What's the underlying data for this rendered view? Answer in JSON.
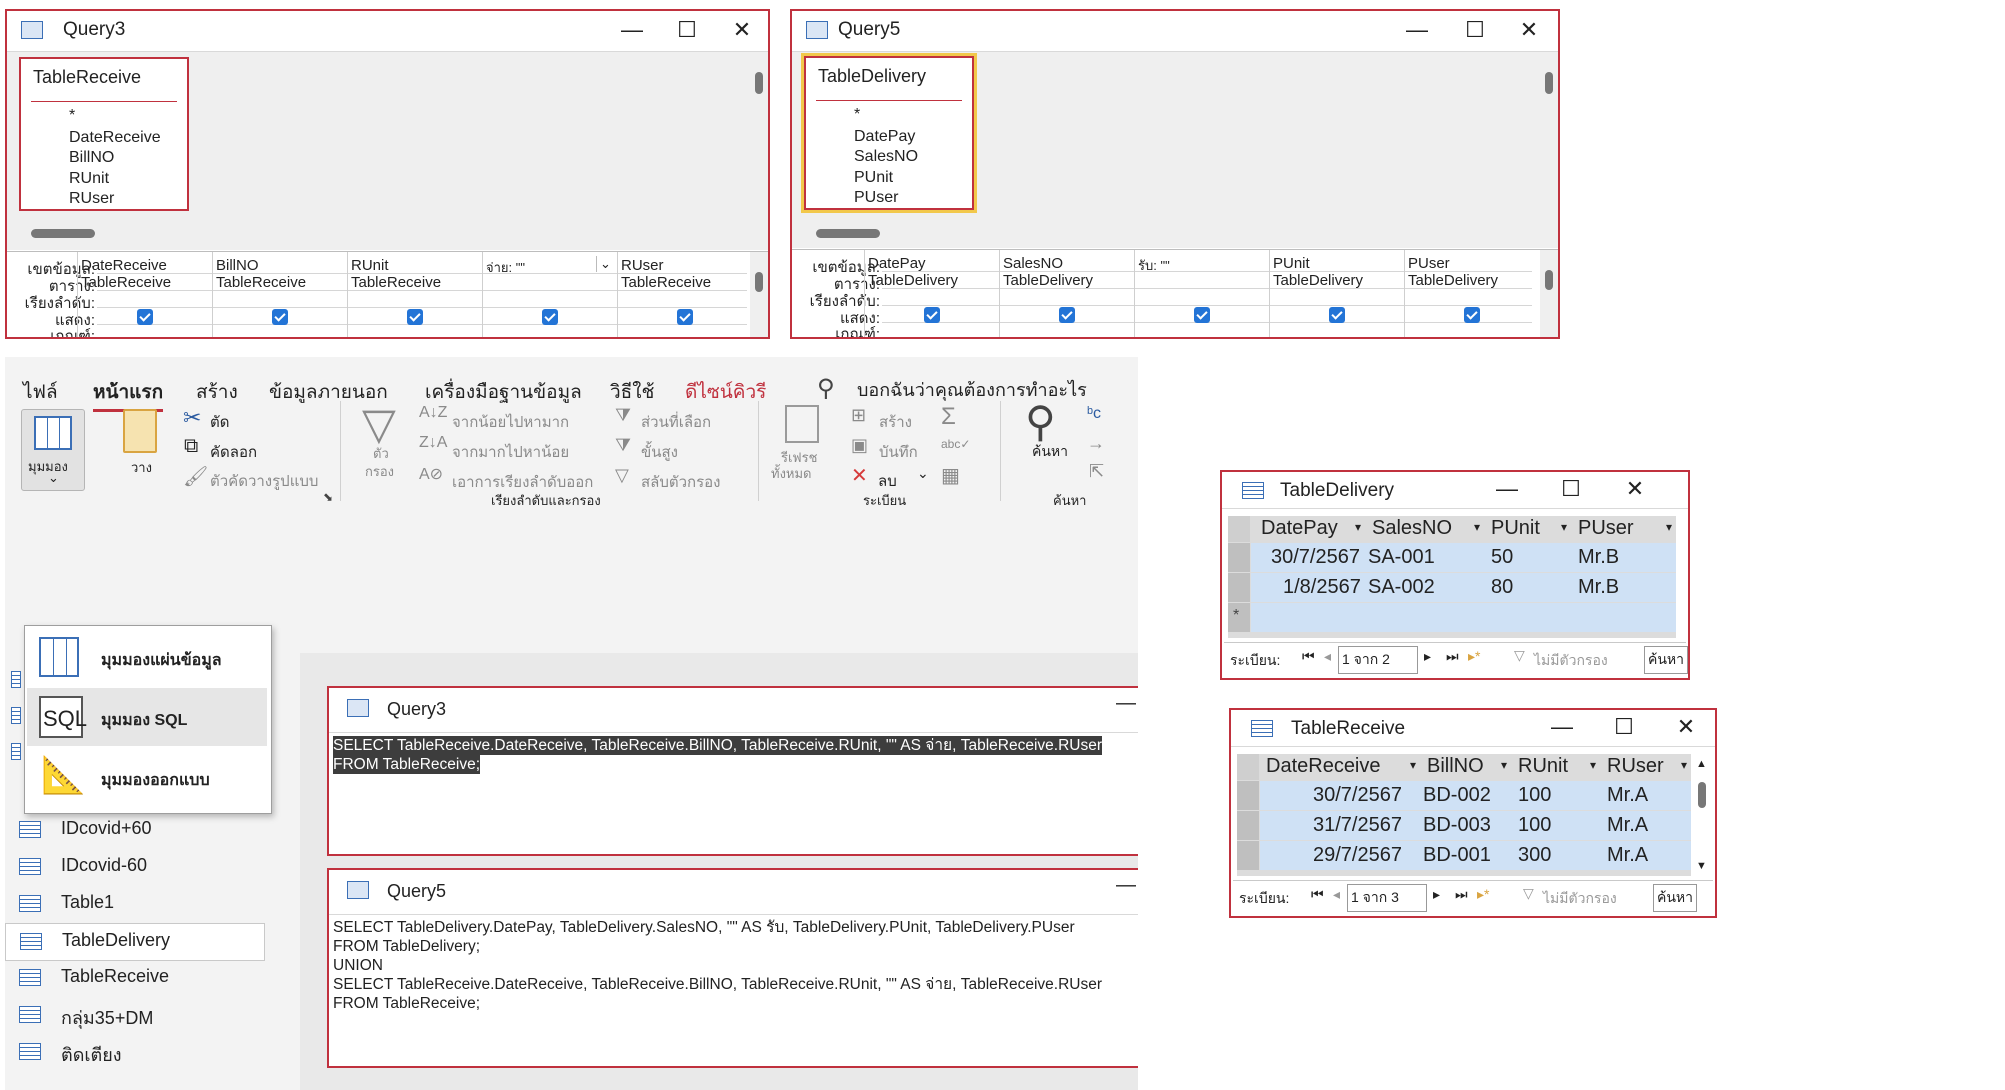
{
  "query3_window": {
    "title": "Query3",
    "table_name": "TableReceive",
    "fields": [
      "*",
      "DateReceive",
      "BillNO",
      "RUnit",
      "RUser"
    ],
    "grid_labels": {
      "field": "เขตข้อมูล:",
      "table": "ตาราง:",
      "sort": "เรียงลำดับ:",
      "show": "แสดง:",
      "criteria": "เกณฑ์:"
    },
    "columns": [
      {
        "field": "DateReceive",
        "table": "TableReceive"
      },
      {
        "field": "BillNO",
        "table": "TableReceive"
      },
      {
        "field": "RUnit",
        "table": "TableReceive"
      },
      {
        "field": "จ่าย: \"\"",
        "table": ""
      },
      {
        "field": "RUser",
        "table": "TableReceive"
      }
    ]
  },
  "query5_window": {
    "title": "Query5",
    "table_name": "TableDelivery",
    "fields": [
      "*",
      "DatePay",
      "SalesNO",
      "PUnit",
      "PUser"
    ],
    "grid_labels": {
      "field": "เขตข้อมูล:",
      "table": "ตาราง:",
      "sort": "เรียงลำดับ:",
      "show": "แสดง:",
      "criteria": "เกณฑ์:"
    },
    "columns": [
      {
        "field": "DatePay",
        "table": "TableDelivery"
      },
      {
        "field": "SalesNO",
        "table": "TableDelivery"
      },
      {
        "field": "รับ: \"\"",
        "table": ""
      },
      {
        "field": "PUnit",
        "table": "TableDelivery"
      },
      {
        "field": "PUser",
        "table": "TableDelivery"
      }
    ]
  },
  "ribbon": {
    "tabs": [
      "ไฟล์",
      "หน้าแรก",
      "สร้าง",
      "ข้อมูลภายนอก",
      "เครื่องมือฐานข้อมูล",
      "วิธีใช้",
      "ดีไซน์คิวรี"
    ],
    "tell_me": "บอกฉันว่าคุณต้องการทำอะไร",
    "view_label": "มุมมอง",
    "paste_label": "วาง",
    "cut_label": "ตัด",
    "copy_label": "คัดลอก",
    "format_painter_label": "ตัวคัดวางรูปแบบ",
    "filter_label_1": "ตัว",
    "filter_label_2": "กรอง",
    "asc_label": "จากน้อยไปหามาก",
    "desc_label": "จากมากไปหาน้อย",
    "remove_sort_label": "เอาการเรียงลำดับออก",
    "selection_label": "ส่วนที่เลือก",
    "advanced_label": "ขั้นสูง",
    "toggle_filter_label": "สลับตัวกรอง",
    "sort_filter_group": "เรียงลำดับและกรอง",
    "refresh_label_1": "รีเฟรช",
    "refresh_label_2": "ทั้งหมด",
    "new_label": "สร้าง",
    "save_label": "บันทึก",
    "delete_label": "ลบ",
    "records_group": "ระเบียน",
    "find_label": "ค้นหา",
    "find_group": "ค้นหา"
  },
  "view_menu": {
    "items": [
      "มุมมองแผ่นข้อมูล",
      "มุมมอง SQL",
      "มุมมองออกแบบ"
    ],
    "sql_icon_text": "SQL"
  },
  "nav_pane": {
    "items": [
      "IDcovid+60",
      "IDcovid-60",
      "Table1",
      "TableDelivery",
      "TableReceive",
      "กลุ่ม35+DM",
      "ติดเตียง"
    ]
  },
  "sql_query3": {
    "title": "Query3",
    "lines": [
      "SELECT TableReceive.DateReceive, TableReceive.BillNO, TableReceive.RUnit, \"\" AS จ่าย, TableReceive.RUser",
      "FROM TableReceive;"
    ]
  },
  "sql_query5": {
    "title": "Query5",
    "lines": [
      "SELECT TableDelivery.DatePay, TableDelivery.SalesNO, \"\" AS รับ, TableDelivery.PUnit, TableDelivery.PUser",
      "FROM TableDelivery;",
      "UNION",
      "SELECT TableReceive.DateReceive, TableReceive.BillNO, TableReceive.RUnit, \"\" AS จ่าย, TableReceive.RUser",
      "FROM TableReceive;"
    ]
  },
  "ds_delivery": {
    "title": "TableDelivery",
    "headers": [
      "DatePay",
      "SalesNO",
      "PUnit",
      "PUser"
    ],
    "rows": [
      [
        "30/7/2567",
        "SA-001",
        "50",
        "Mr.B"
      ],
      [
        "1/8/2567",
        "SA-002",
        "80",
        "Mr.B"
      ]
    ],
    "nav_label": "ระเบียน:",
    "position": "1 จาก 2",
    "no_filter": "ไม่มีตัวกรอง",
    "search": "ค้นหา"
  },
  "ds_receive": {
    "title": "TableReceive",
    "headers": [
      "DateReceive",
      "BillNO",
      "RUnit",
      "RUser"
    ],
    "rows": [
      [
        "30/7/2567",
        "BD-002",
        "100",
        "Mr.A"
      ],
      [
        "31/7/2567",
        "BD-003",
        "100",
        "Mr.A"
      ],
      [
        "29/7/2567",
        "BD-001",
        "300",
        "Mr.A"
      ]
    ],
    "nav_label": "ระเบียน:",
    "position": "1 จาก 3",
    "no_filter": "ไม่มีตัวกรอง",
    "search": "ค้นหา"
  },
  "colors": {
    "accent_border": "#c0313e",
    "selection_blue": "#cfe1f5",
    "checkbox_blue": "#2374d6",
    "active_tab": "#c0313e"
  }
}
